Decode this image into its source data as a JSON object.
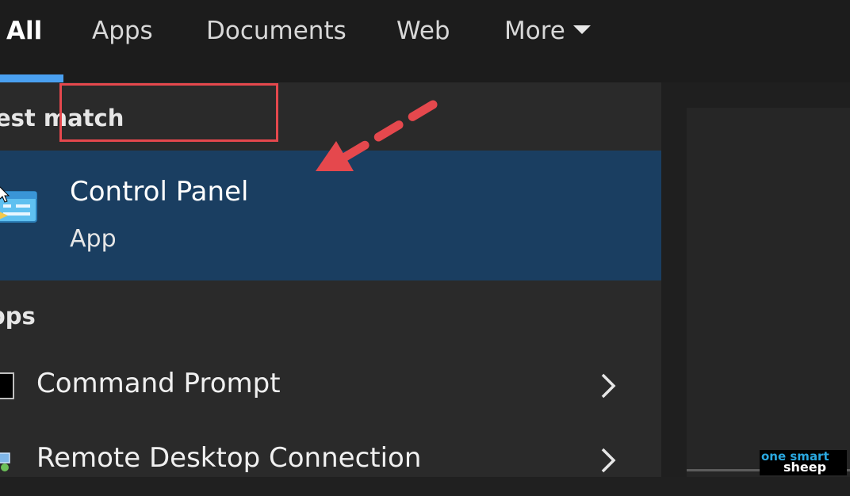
{
  "tabs": [
    {
      "label": "All",
      "active": true
    },
    {
      "label": "Apps",
      "active": false
    },
    {
      "label": "Documents",
      "active": false
    },
    {
      "label": "Web",
      "active": false
    },
    {
      "label": "More",
      "active": false
    }
  ],
  "best_match": {
    "heading": "est match",
    "title": "Control Panel",
    "subtitle": "App",
    "icon": "control-panel-icon"
  },
  "apps_section": {
    "heading": "pps",
    "items": [
      {
        "label": "Command Prompt",
        "icon": "command-prompt-icon"
      },
      {
        "label": "Remote Desktop Connection",
        "icon": "remote-desktop-icon"
      }
    ]
  },
  "annotation": {
    "color": "#e5484d",
    "shape": "dashed-arrow-and-box"
  },
  "watermark": {
    "line1": "one smart",
    "line2": "sheep"
  },
  "colors": {
    "accent": "#4aa0f0",
    "selected_row": "#1a3e61",
    "background": "#2a2a2a"
  }
}
